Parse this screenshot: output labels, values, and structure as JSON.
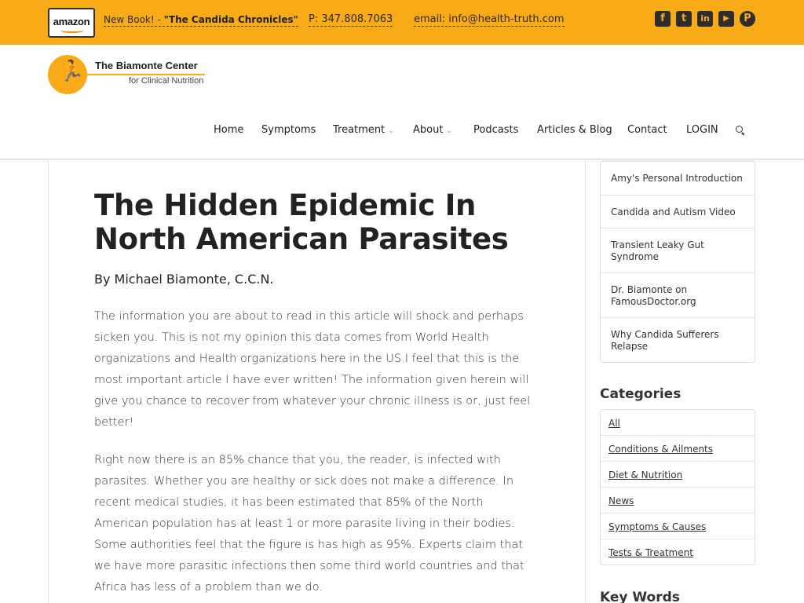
{
  "topbar": {
    "amazon_label": "amazon",
    "new_book_prefix": "New Book! - ",
    "new_book_title": "\"The Candida Chronicles\"",
    "phone": "P: 347.808.7063",
    "email": "email: info@health-truth.com",
    "social_icons": [
      "facebook-icon",
      "twitter-icon",
      "linkedin-icon",
      "youtube-icon",
      "pinterest-icon"
    ],
    "social_glyphs": {
      "facebook": "f",
      "twitter": "t",
      "linkedin": "in",
      "youtube": "▶",
      "pinterest": "P"
    },
    "background_color": "#f8ab16"
  },
  "logo": {
    "title": "The Biamonte Center",
    "subtitle": "for Clinical Nutrition",
    "runner_glyph": "🏃",
    "accent_color": "#f8ab16"
  },
  "nav": {
    "items": [
      {
        "label": "Home",
        "has_dropdown": false
      },
      {
        "label": "Symptoms",
        "has_dropdown": false
      },
      {
        "label": "Treatment",
        "has_dropdown": true
      },
      {
        "label": "About",
        "has_dropdown": true
      },
      {
        "label": "Podcasts",
        "has_dropdown": false
      },
      {
        "label": "Articles & Blog",
        "has_dropdown": false
      },
      {
        "label": "Contact",
        "has_dropdown": false
      },
      {
        "label": "LOGIN",
        "has_dropdown": false
      }
    ],
    "chevron": "⌄"
  },
  "article": {
    "title": "The Hidden Epidemic In North American Parasites",
    "byline": "By Michael Biamonte, C.C.N.",
    "paragraphs": [
      "The information you are about to read in this article will shock and perhaps sicken you. This is not my opinion this data comes from World Health organizations and Health organizations here in the US.I feel that this is the most important article I have ever written! The information given herein will give you chance to recover from whatever your chronic illness is or, just feel better!",
      "Right now there is an 85% chance that you, the reader, is infected with parasites. Whether you are healthy or sick does not make a difference. In recent medical studies, it has been estimated that 85% of the North American population has at least 1 or more parasite living in their bodies. Some authorities feel that the figure is has high as 95%. Experts claim that we have more parasitic infections then some third world countries and that Africa has less of a problem than we do."
    ]
  },
  "sidebar": {
    "video_links": [
      "Amy's Personal Introduction",
      "Candida and Autism Video",
      "Transient Leaky Gut Syndrome",
      "Dr. Biamonte on FamousDoctor.org",
      "Why Candida Sufferers Relapse"
    ],
    "categories_heading": "Categories",
    "categories": [
      "All",
      "Conditions & Ailments",
      "Diet & Nutrition",
      "News",
      "Symptoms & Causes",
      "Tests & Treatment"
    ],
    "keywords_heading": "Key Words"
  }
}
